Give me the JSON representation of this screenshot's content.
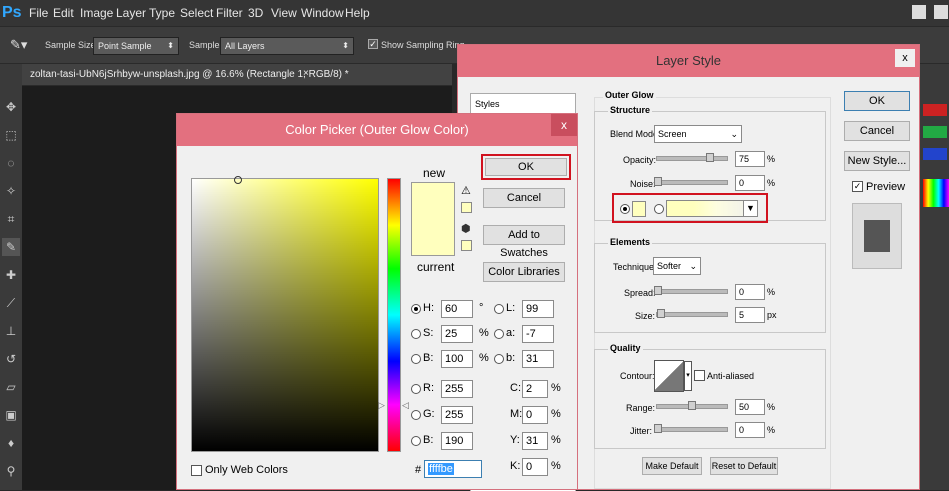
{
  "app": {
    "logo": "Ps"
  },
  "menu": [
    "File",
    "Edit",
    "Image",
    "Layer",
    "Type",
    "Select",
    "Filter",
    "3D",
    "View",
    "Window",
    "Help"
  ],
  "options": {
    "sample_size_label": "Sample Size:",
    "sample_size_value": "Point Sample",
    "sample_label": "Sample:",
    "sample_value": "All Layers",
    "show_ring_label": "Show Sampling Ring"
  },
  "document_tab": "zoltan-tasi-UbN6jSrhbyw-unsplash.jpg @ 16.6% (Rectangle 1, RGB/8) *",
  "color_picker": {
    "title": "Color Picker (Outer Glow Color)",
    "close": "x",
    "ok": "OK",
    "cancel": "Cancel",
    "add_swatches": "Add to Swatches",
    "color_libraries": "Color Libraries",
    "new_label": "new",
    "current_label": "current",
    "only_web_colors": "Only Web Colors",
    "hex_label": "#",
    "hex": "ffffbe",
    "new_color": "#ffffbe",
    "current_color": "#ffffbe",
    "hue_color": "#ffff00",
    "fields": {
      "H": {
        "label": "H:",
        "value": "60",
        "unit": "°"
      },
      "S": {
        "label": "S:",
        "value": "25",
        "unit": "%"
      },
      "B": {
        "label": "B:",
        "value": "100",
        "unit": "%"
      },
      "R": {
        "label": "R:",
        "value": "255"
      },
      "G": {
        "label": "G:",
        "value": "255"
      },
      "Bl": {
        "label": "B:",
        "value": "190"
      },
      "L": {
        "label": "L:",
        "value": "99"
      },
      "a": {
        "label": "a:",
        "value": "-7"
      },
      "b": {
        "label": "b:",
        "value": "31"
      },
      "C": {
        "label": "C:",
        "value": "2",
        "unit": "%"
      },
      "M": {
        "label": "M:",
        "value": "0",
        "unit": "%"
      },
      "Y": {
        "label": "Y:",
        "value": "31",
        "unit": "%"
      },
      "K": {
        "label": "K:",
        "value": "0",
        "unit": "%"
      }
    }
  },
  "layer_style": {
    "title": "Layer Style",
    "close": "x",
    "styles_label": "Styles",
    "ok": "OK",
    "cancel": "Cancel",
    "new_style": "New Style...",
    "preview": "Preview",
    "outer_glow": "Outer Glow",
    "structure": "Structure",
    "blend_mode_label": "Blend Mode:",
    "blend_mode": "Screen",
    "opacity_label": "Opacity:",
    "opacity": "75",
    "noise_label": "Noise:",
    "noise": "0",
    "percent": "%",
    "elements": "Elements",
    "technique_label": "Technique:",
    "technique": "Softer",
    "spread_label": "Spread:",
    "spread": "0",
    "size_label": "Size:",
    "size": "5",
    "px": "px",
    "quality": "Quality",
    "contour_label": "Contour:",
    "anti_aliased": "Anti-aliased",
    "range_label": "Range:",
    "range": "50",
    "jitter_label": "Jitter:",
    "jitter": "0",
    "make_default": "Make Default",
    "reset_default": "Reset to Default",
    "glow_color": "#ffffbe"
  }
}
